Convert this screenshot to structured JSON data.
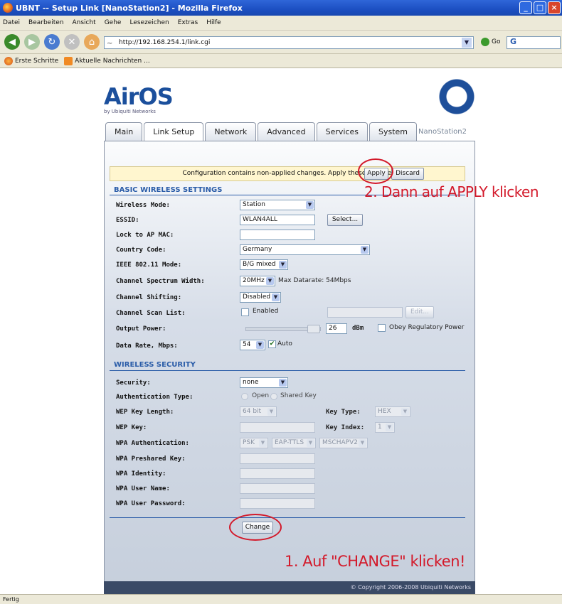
{
  "window": {
    "title": "UBNT -- Setup Link [NanoStation2] - Mozilla Firefox",
    "controls": [
      "_",
      "□",
      "×"
    ]
  },
  "menu": [
    "Datei",
    "Bearbeiten",
    "Ansicht",
    "Gehe",
    "Lesezeichen",
    "Extras",
    "Hilfe"
  ],
  "nav": {
    "url": "http://192.168.254.1/link.cgi",
    "go_label": "Go",
    "search_label": "G"
  },
  "bookmarks": [
    "Erste Schritte",
    "Aktuelle Nachrichten ..."
  ],
  "status": "Fertig",
  "page": {
    "logo": "AirOS",
    "logo_sub": "by Ubiquiti Networks",
    "badge": "4",
    "model": "NanoStation2",
    "tabs": [
      "Main",
      "Link Setup",
      "Network",
      "Advanced",
      "Services",
      "System"
    ],
    "active_tab": "Link Setup",
    "notice": "Configuration contains non-applied changes. Apply these changes",
    "apply_label": "Apply",
    "discard_label": "Discard",
    "basic_title": "BASIC WIRELESS SETTINGS",
    "wireless_mode_label": "Wireless Mode:",
    "wireless_mode": "Station",
    "essid_label": "ESSID:",
    "essid": "WLAN4ALL",
    "select_label": "Select...",
    "lock_ap_label": "Lock to AP MAC:",
    "country_label": "Country Code:",
    "country": "Germany",
    "ieee_label": "IEEE 802.11 Mode:",
    "ieee": "B/G mixed",
    "spectrum_label": "Channel Spectrum Width:",
    "spectrum": "20MHz",
    "max_datarate": "Max Datarate: 54Mbps",
    "shifting_label": "Channel Shifting:",
    "shifting": "Disabled",
    "scan_label": "Channel Scan List:",
    "scan_enabled": "Enabled",
    "edit_label": "Edit...",
    "output_label": "Output Power:",
    "output_value": "26",
    "output_unit": "dBm",
    "obey_label": "Obey Regulatory Power",
    "datarate_label": "Data Rate, Mbps:",
    "datarate": "54",
    "auto_label": "Auto",
    "security_title": "WIRELESS SECURITY",
    "security_label": "Security:",
    "security": "none",
    "auth_label": "Authentication Type:",
    "auth_open": "Open",
    "auth_shared": "Shared Key",
    "wep_len_label": "WEP Key Length:",
    "wep_len": "64 bit",
    "key_type_label": "Key Type:",
    "key_type": "HEX",
    "wep_key_label": "WEP Key:",
    "key_index_label": "Key Index:",
    "key_index": "1",
    "wpa_auth_label": "WPA Authentication:",
    "wpa_auth_1": "PSK",
    "wpa_auth_2": "EAP-TTLS",
    "wpa_auth_3": "MSCHAPV2",
    "wpa_psk_label": "WPA Preshared Key:",
    "wpa_identity_label": "WPA Identity:",
    "wpa_user_label": "WPA User Name:",
    "wpa_pass_label": "WPA User Password:",
    "change_label": "Change",
    "copyright": "© Copyright 2006-2008 Ubiquiti Networks"
  },
  "annotations": {
    "step2": "2. Dann auf APPLY klicken",
    "step1": "1. Auf \"CHANGE\" klicken!",
    "color": "#d3192a"
  }
}
